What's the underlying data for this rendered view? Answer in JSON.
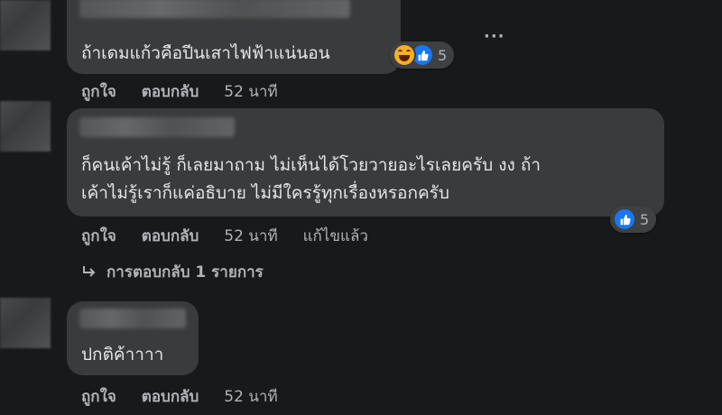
{
  "comments": [
    {
      "text_lines": [
        "ถ้าเดมแก้วคือปีนเสาไฟฟ้าแน่นอน"
      ],
      "reaction_count": "5",
      "reactions": [
        "haha-icon",
        "like-icon"
      ],
      "actions": {
        "like": "ถูกใจ",
        "reply": "ตอบกลับ",
        "time": "52 นาที"
      }
    },
    {
      "text_lines": [
        "ก็คนเค้าไม่รู้ ก็เลยมาถาม ไม่เห็นได้โวยวายอะไรเลยครับ งง ถ้า",
        "เค้าไม่รู้เราก็แค่อธิบาย ไม่มีใครรู้ทุกเรื่องหรอกครับ"
      ],
      "reaction_count": "5",
      "reactions": [
        "like-icon"
      ],
      "actions": {
        "like": "ถูกใจ",
        "reply": "ตอบกลับ",
        "time": "52 นาที",
        "edited": "แก้ไขแล้ว"
      },
      "replies_link": "การตอบกลับ 1 รายการ"
    },
    {
      "text_lines": [
        "ปกติค้าาาา"
      ],
      "actions": {
        "like": "ถูกใจ",
        "reply": "ตอบกลับ",
        "time": "52 นาที"
      }
    }
  ],
  "more_options": "···",
  "colors": {
    "background": "#18191a",
    "bubble": "#3a3b3c",
    "like_blue": "#1877f2",
    "secondary_text": "#b0b3b8"
  }
}
